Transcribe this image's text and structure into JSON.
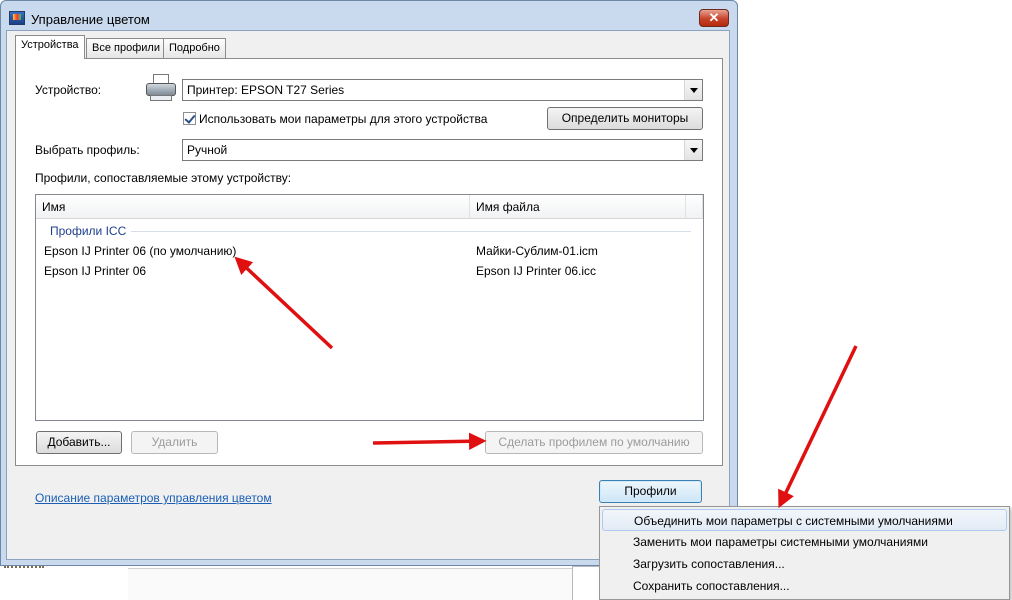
{
  "window": {
    "title": "Управление цветом",
    "close_label": "✕"
  },
  "tabs": [
    {
      "label": "Устройства",
      "active": true
    },
    {
      "label": "Все профили",
      "active": false
    },
    {
      "label": "Подробно",
      "active": false
    }
  ],
  "device": {
    "label": "Устройство:",
    "value": "Принтер: EPSON T27 Series",
    "use_my_settings_label": "Использовать мои параметры для этого устройства",
    "use_my_settings_checked": true,
    "identify_monitors_label": "Определить мониторы"
  },
  "profile_select": {
    "label": "Выбрать профиль:",
    "value": "Ручной"
  },
  "profiles_list": {
    "caption": "Профили, сопоставляемые этому устройству:",
    "columns": [
      "Имя",
      "Имя файла"
    ],
    "group": "Профили ICC",
    "rows": [
      {
        "name": "Epson IJ Printer 06 (по умолчанию)",
        "file": "Майки-Сублим-01.icm"
      },
      {
        "name": "Epson IJ Printer 06",
        "file": "Epson IJ Printer 06.icc"
      }
    ]
  },
  "buttons": {
    "add": "Добавить...",
    "remove": "Удалить",
    "set_default": "Сделать профилем по умолчанию",
    "profiles": "Профили"
  },
  "help_link": "Описание параметров управления цветом",
  "profiles_menu": [
    {
      "label": "Объединить мои параметры с системными умолчаниями",
      "highlighted": true
    },
    {
      "label": "Заменить мои параметры системными умолчаниями",
      "highlighted": false
    },
    {
      "label": "Загрузить сопоставления...",
      "highlighted": false
    },
    {
      "label": "Сохранить сопоставления...",
      "highlighted": false
    }
  ],
  "colors": {
    "annotation_arrow": "#e01010",
    "link": "#1a5fb4",
    "group_header": "#1e3f8a"
  }
}
